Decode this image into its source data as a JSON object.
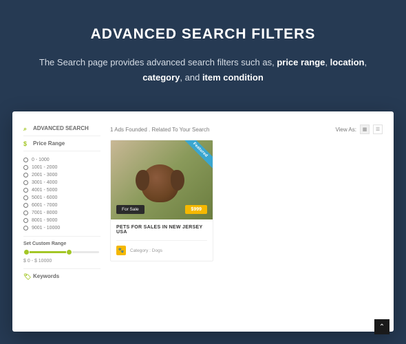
{
  "hero": {
    "title": "ADVANCED SEARCH FILTERS",
    "lead": "The Search page provides advanced search filters such as, ",
    "f1": "price range",
    "c1": ", ",
    "f2": "location",
    "c2": ", ",
    "f3": "category",
    "c3": ", and ",
    "f4": "item condition"
  },
  "sidebar": {
    "search_title": "ADVANCED SEARCH",
    "price_title": "Price Range",
    "ranges": [
      "0 - 1000",
      "1001 - 2000",
      "2001 - 3000",
      "3001 - 4000",
      "4001 - 5000",
      "5001 - 6000",
      "6001 - 7000",
      "7001 - 8000",
      "8001 - 9000",
      "9001 - 10000"
    ],
    "custom_label": "Set Custom Range",
    "custom_value": "$ 0 - $ 10000",
    "keywords_title": "Keywords"
  },
  "results": {
    "summary": "1 Ads Founded . Related To Your Search",
    "view_as": "View As:"
  },
  "card": {
    "ribbon": "Featured",
    "sale": "For Sale",
    "price": "$999",
    "title": "PETS FOR SALES IN NEW JERSEY USA",
    "category": "Category : Dogs",
    "paw": "🐾"
  }
}
